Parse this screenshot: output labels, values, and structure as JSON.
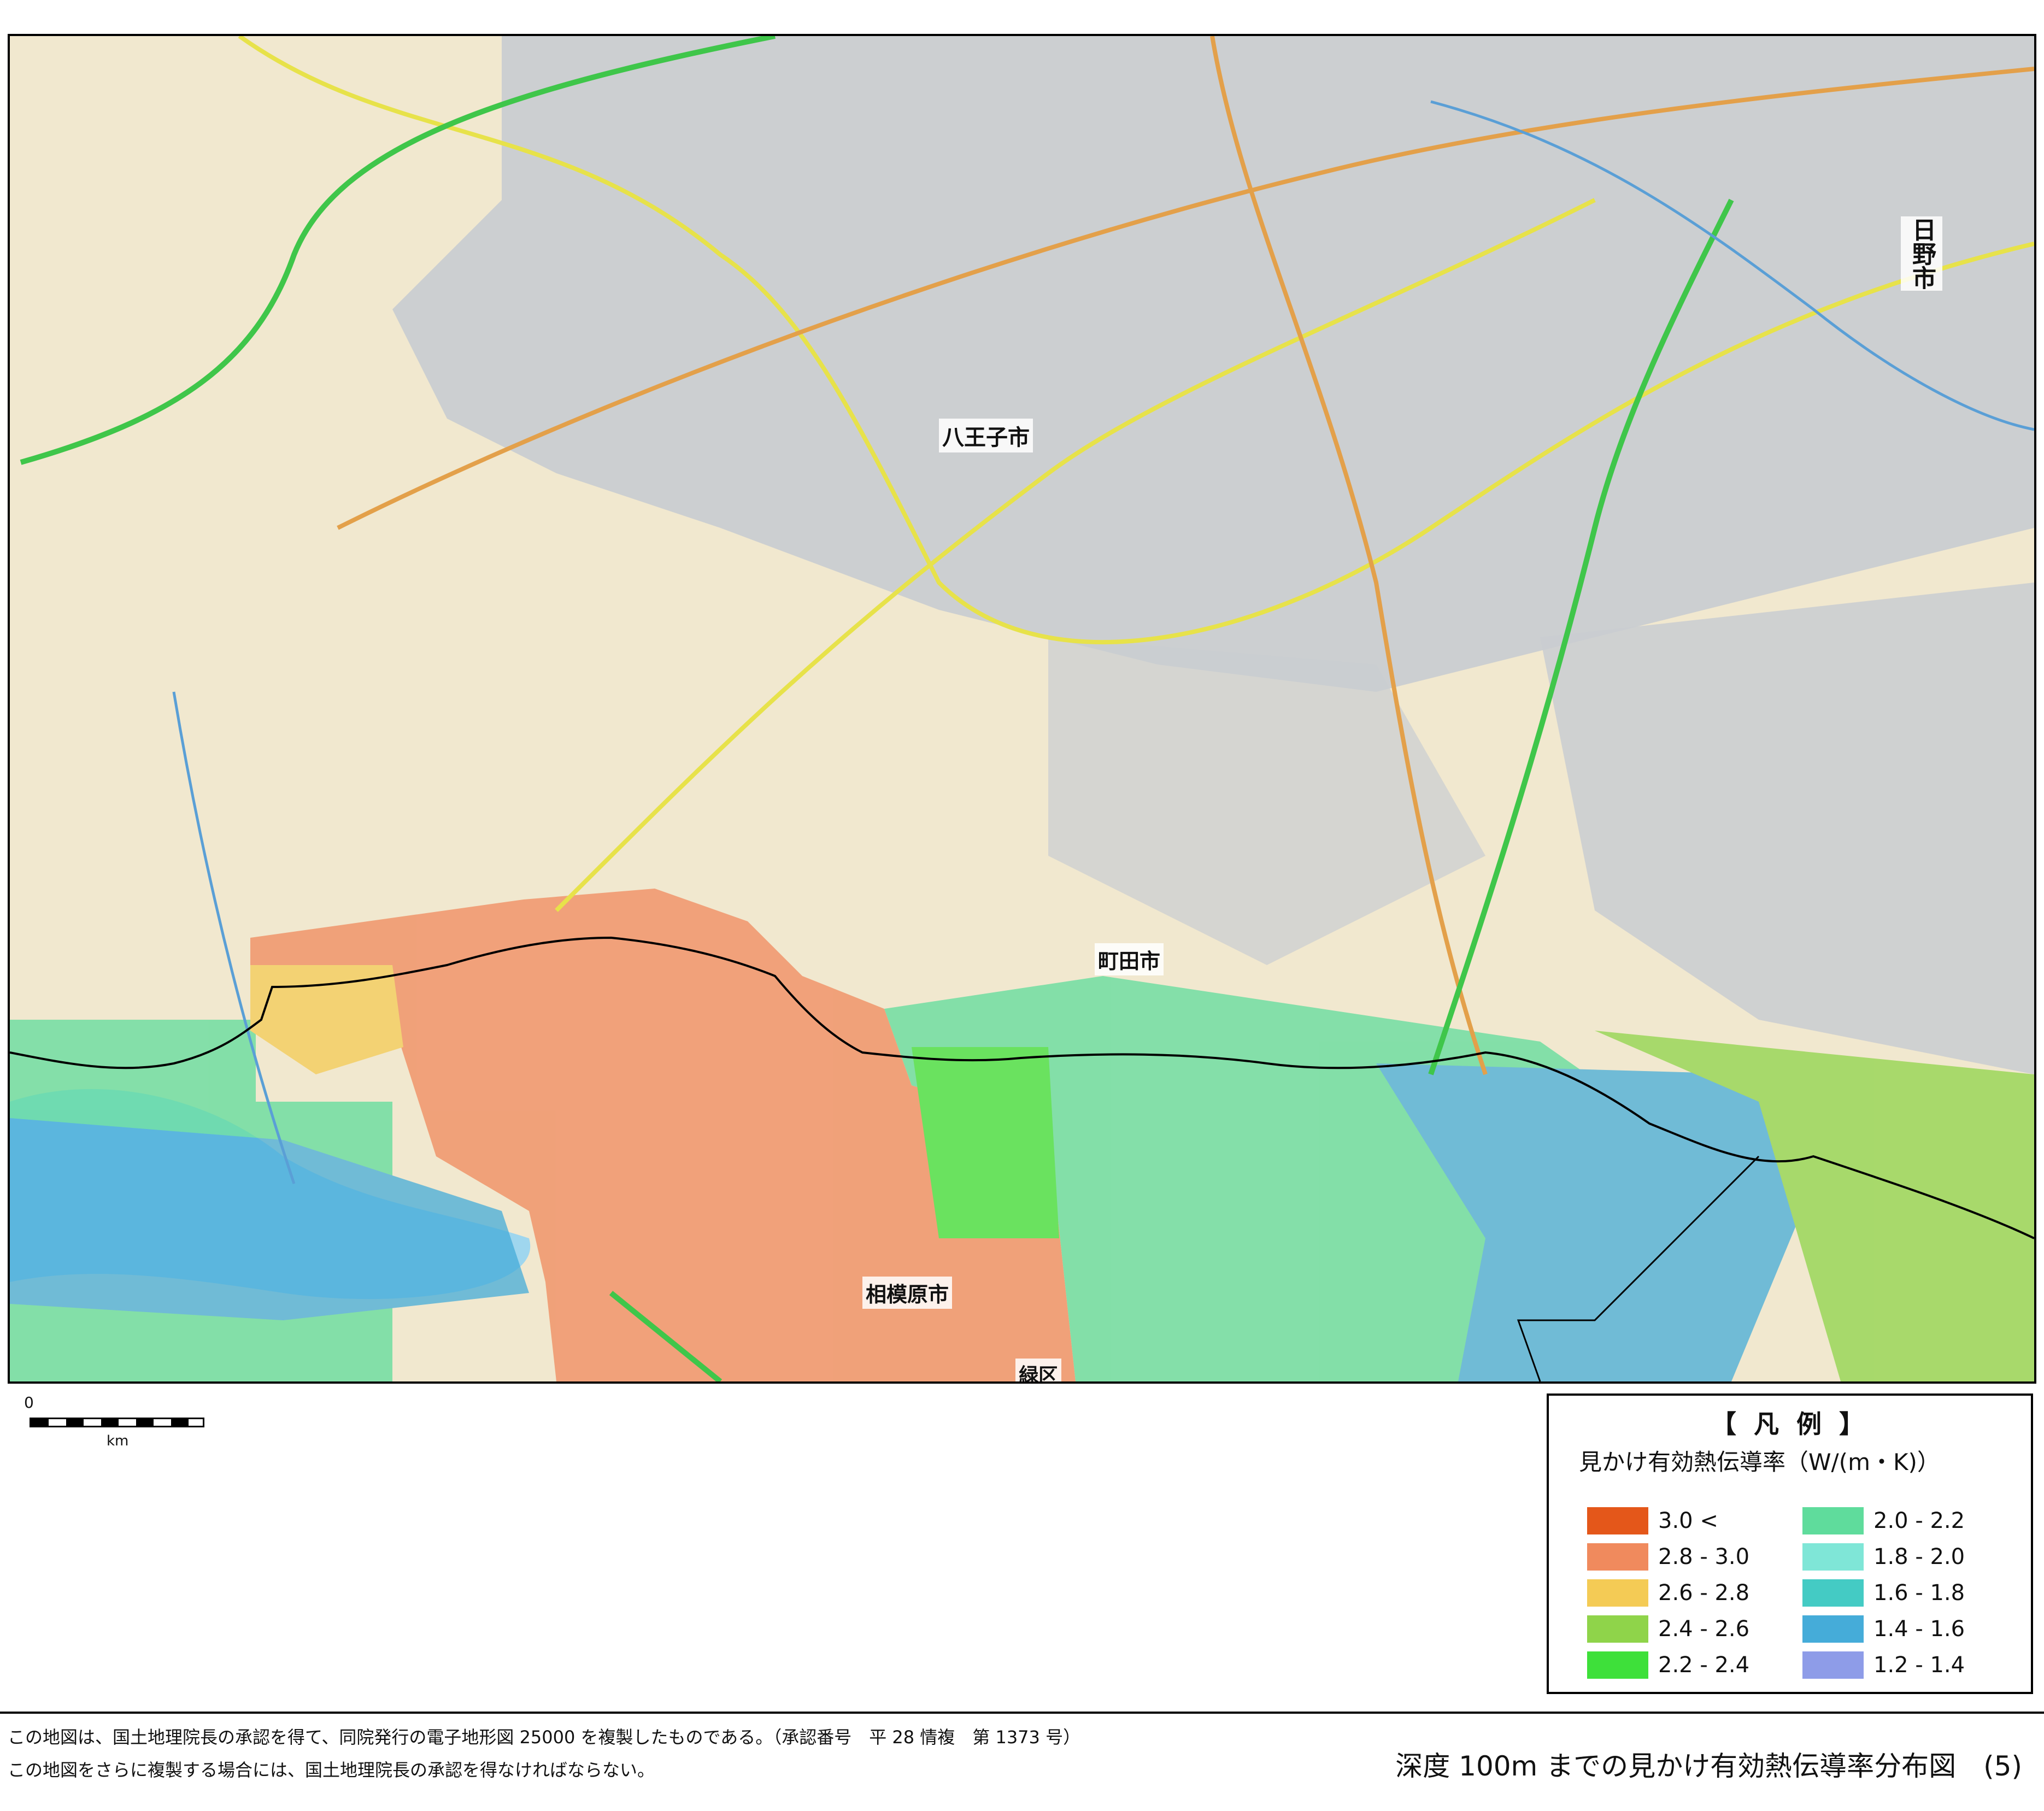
{
  "map": {
    "labels": [
      {
        "key": "hachioji",
        "text": "八王子市"
      },
      {
        "key": "hino",
        "text": "日野市"
      },
      {
        "key": "machida",
        "text": "町田市"
      },
      {
        "key": "sagamihara",
        "text": "相模原市"
      },
      {
        "key": "midori",
        "text": "緑区"
      }
    ],
    "colors": {
      "terrain": "#f1e8cf",
      "urban": "#c9cdd1",
      "water": "#9fd6ee",
      "river": "#5a9fd6",
      "road_yellow": "#e7e24a",
      "road_orange": "#e3a04a",
      "railway_green": "#3fc64a",
      "boundary": "#000000"
    }
  },
  "scale": {
    "zero": "0",
    "unit": "km"
  },
  "legend": {
    "title": "【 凡 例 】",
    "subtitle": "見かけ有効熱伝導率（W/(m・K)）",
    "items": [
      {
        "label": "3.0 <",
        "color": "#e4571a"
      },
      {
        "label": "2.8 - 3.0",
        "color": "#f08a5d"
      },
      {
        "label": "2.6 - 2.8",
        "color": "#f4cb55"
      },
      {
        "label": "2.4 - 2.6",
        "color": "#8fd44a"
      },
      {
        "label": "2.2 - 2.4",
        "color": "#3ee03a"
      },
      {
        "label": "2.0 - 2.2",
        "color": "#5fdc9c"
      },
      {
        "label": "1.8 - 2.0",
        "color": "#7fe6d7"
      },
      {
        "label": "1.6 - 1.8",
        "color": "#44cbc4"
      },
      {
        "label": "1.4 - 1.6",
        "color": "#45acd9"
      },
      {
        "label": "1.2 - 1.4",
        "color": "#8e9ce8"
      }
    ]
  },
  "footer": {
    "note1": "この地図は、国土地理院長の承認を得て、同院発行の電子地形図 25000 を複製したものである。（承認番号　平 28 情複　第 1373 号）",
    "note2": "この地図をさらに複製する場合には、国土地理院長の承認を得なければならない。",
    "title": "深度 100m までの見かけ有効熱伝導率分布図　(5)"
  }
}
